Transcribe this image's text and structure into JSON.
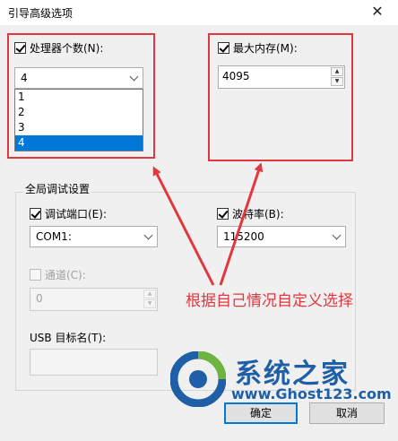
{
  "window": {
    "title": "引导高级选项",
    "close_glyph": "✕"
  },
  "processor": {
    "label": "处理器个数(N):",
    "checked": true,
    "selected": "4",
    "options": [
      "1",
      "2",
      "3",
      "4"
    ]
  },
  "memory": {
    "label": "最大内存(M):",
    "checked": true,
    "value": "4095"
  },
  "debug_group": {
    "title": "全局调试设置",
    "debug_port": {
      "label": "调试端口(E):",
      "checked": true,
      "value": "COM1:"
    },
    "baud_rate": {
      "label": "波特率(B):",
      "checked": true,
      "value": "115200"
    },
    "channel": {
      "label": "通道(C):",
      "checked": false,
      "value": "0"
    },
    "usb_target": {
      "label": "USB 目标名(T):",
      "value": ""
    }
  },
  "buttons": {
    "ok": "确定",
    "cancel": "取消"
  },
  "annotation": {
    "text": "根据自己情况自定义选择",
    "color": "#e0383e"
  },
  "watermark": {
    "name": "系统之家",
    "url": "www.Ghost123.com"
  },
  "icons": [
    "close-icon",
    "checkbox-check-icon",
    "chevron-down-icon",
    "spinner-up-icon",
    "spinner-down-icon",
    "ghost-logo-icon"
  ]
}
